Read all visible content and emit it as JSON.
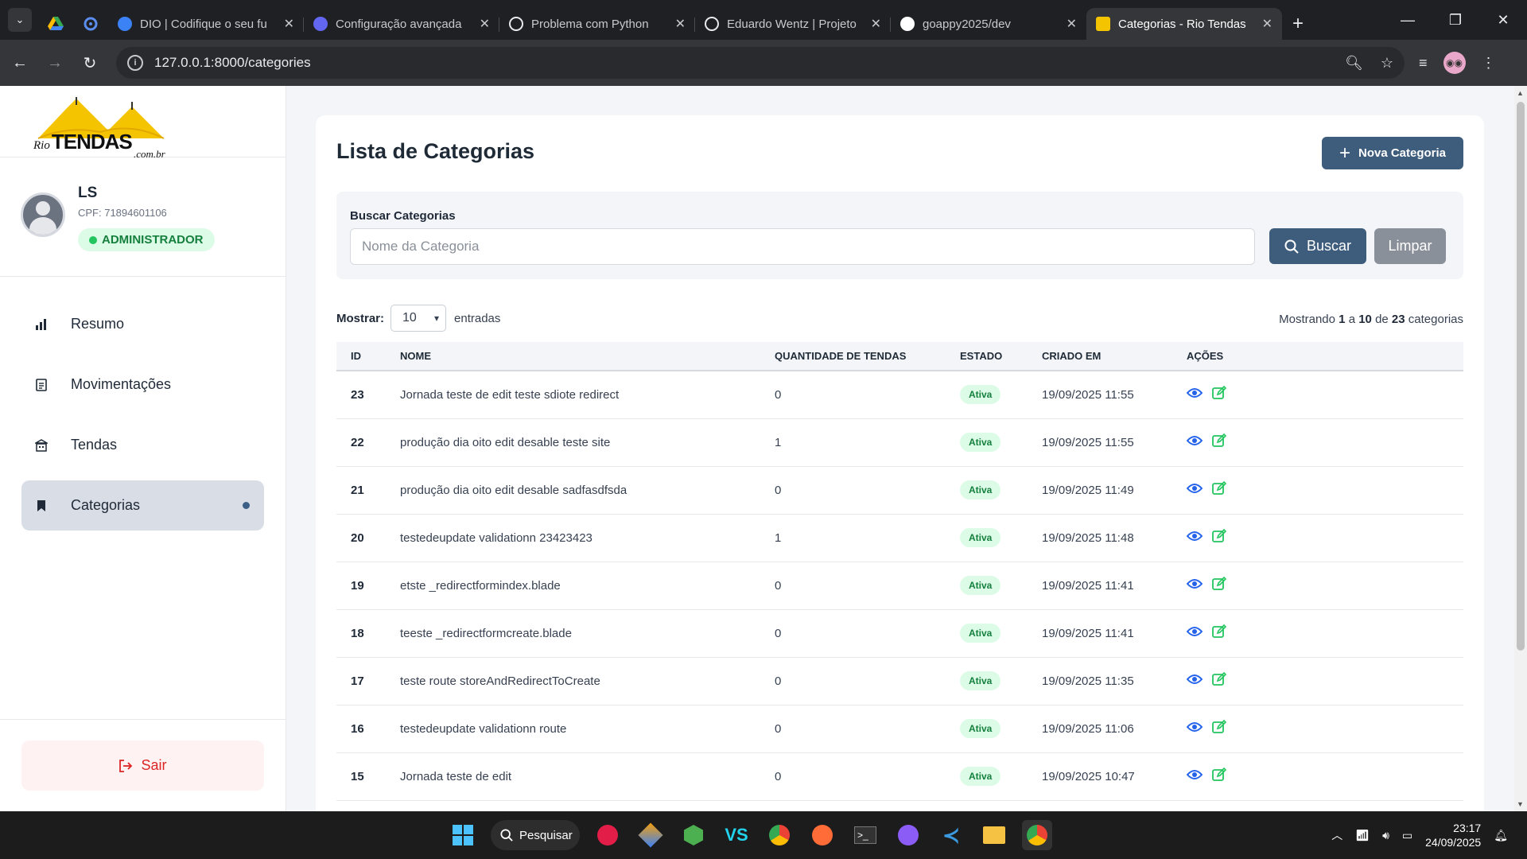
{
  "browser": {
    "tabs": [
      {
        "title": "DIO | Codifique o seu fu",
        "color": "#3b82f6"
      },
      {
        "title": "Configuração avançada",
        "color": "#6366f1"
      },
      {
        "title": "Problema com Python",
        "color": "#e8eaed"
      },
      {
        "title": "Eduardo Wentz | Projeto",
        "color": "#e8eaed"
      },
      {
        "title": "goappy2025/dev",
        "color": "#ffffff"
      },
      {
        "title": "Categorias - Rio Tendas",
        "color": "#f5c400"
      }
    ],
    "url": "127.0.0.1:8000/categories"
  },
  "sidebar": {
    "logo_text": "TENDAS",
    "logo_prefix": "Rio",
    "logo_suffix": ".com.br",
    "user": {
      "name": "LS",
      "cpf": "CPF: 71894601106",
      "role": "ADMINISTRADOR"
    },
    "menu": [
      {
        "label": "Resumo",
        "icon": "bar-chart-icon"
      },
      {
        "label": "Movimentações",
        "icon": "document-icon"
      },
      {
        "label": "Tendas",
        "icon": "building-icon"
      },
      {
        "label": "Categorias",
        "icon": "bookmark-icon",
        "active": true
      }
    ],
    "logout_label": "Sair"
  },
  "page": {
    "title": "Lista de Categorias",
    "new_button": "Nova Categoria",
    "search": {
      "label": "Buscar Categorias",
      "placeholder": "Nome da Categoria",
      "value": "",
      "search_button": "Buscar",
      "clear_button": "Limpar"
    },
    "show": {
      "label": "Mostrar:",
      "value": "10",
      "suffix": "entradas"
    },
    "count": {
      "prefix": "Mostrando",
      "from": "1",
      "sep1": "a",
      "to": "10",
      "sep2": "de",
      "total": "23",
      "suffix": "categorias"
    }
  },
  "table": {
    "headers": [
      "ID",
      "NOME",
      "QUANTIDADE DE TENDAS",
      "ESTADO",
      "CRIADO EM",
      "AÇÕES"
    ],
    "rows": [
      {
        "id": "23",
        "name": "Jornada teste de edit teste sdiote redirect",
        "qty": "0",
        "status": "Ativa",
        "created": "19/09/2025 11:55"
      },
      {
        "id": "22",
        "name": "produção dia oito edit desable teste site",
        "qty": "1",
        "status": "Ativa",
        "created": "19/09/2025 11:55"
      },
      {
        "id": "21",
        "name": "produção dia oito edit desable sadfasdfsda",
        "qty": "0",
        "status": "Ativa",
        "created": "19/09/2025 11:49"
      },
      {
        "id": "20",
        "name": "testedeupdate validationn 23423423",
        "qty": "1",
        "status": "Ativa",
        "created": "19/09/2025 11:48"
      },
      {
        "id": "19",
        "name": "etste _redirectformindex.blade",
        "qty": "0",
        "status": "Ativa",
        "created": "19/09/2025 11:41"
      },
      {
        "id": "18",
        "name": "teeste _redirectformcreate.blade",
        "qty": "0",
        "status": "Ativa",
        "created": "19/09/2025 11:41"
      },
      {
        "id": "17",
        "name": "teste route storeAndRedirectToCreate",
        "qty": "0",
        "status": "Ativa",
        "created": "19/09/2025 11:35"
      },
      {
        "id": "16",
        "name": "testedeupdate validationn route",
        "qty": "0",
        "status": "Ativa",
        "created": "19/09/2025 11:06"
      },
      {
        "id": "15",
        "name": "Jornada teste de edit",
        "qty": "0",
        "status": "Ativa",
        "created": "19/09/2025 10:47"
      }
    ]
  },
  "taskbar": {
    "search_label": "Pesquisar",
    "time": "23:17",
    "date": "24/09/2025"
  },
  "colors": {
    "primary": "#3e5d7c",
    "success": "#22c55e",
    "danger": "#dc2626"
  }
}
